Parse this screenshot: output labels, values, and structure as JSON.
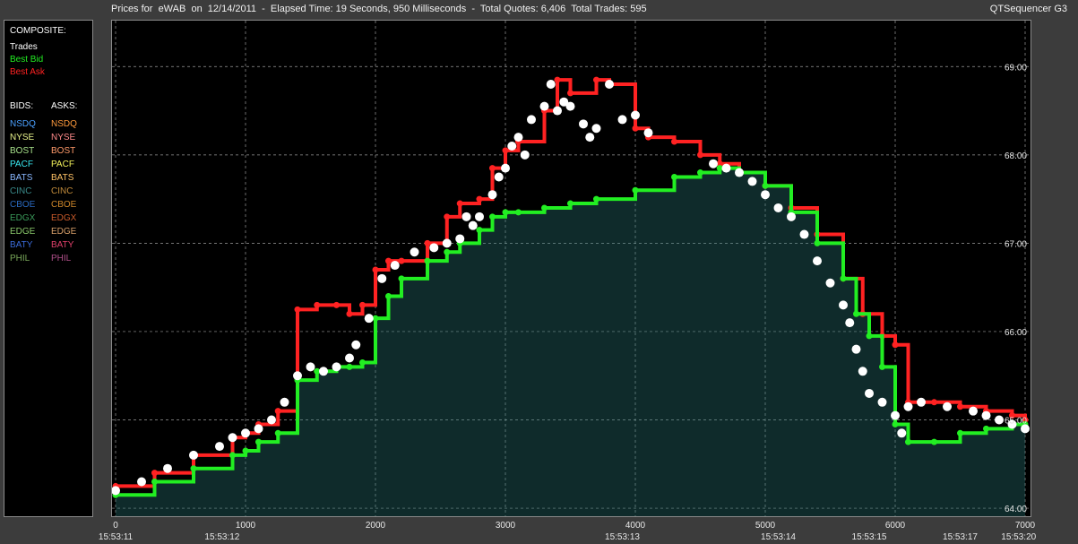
{
  "header": {
    "title": "Prices for  eWAB  on  12/14/2011  -  Elapsed Time: 19 Seconds, 950 Milliseconds  -  Total Quotes: 6,406  Total Trades: 595",
    "app_name": "QTSequencer G3"
  },
  "legend": {
    "composite_title": "COMPOSITE:",
    "composite_items": [
      {
        "label": "Trades",
        "color": "#ffffff"
      },
      {
        "label": "Best Bid",
        "color": "#22ee22"
      },
      {
        "label": "Best Ask",
        "color": "#ff2222"
      }
    ],
    "bids_title": "BIDS:",
    "asks_title": "ASKS:",
    "exchanges": [
      {
        "bid": "NSDQ",
        "ask": "NSDQ",
        "bid_color": "#4aa0ff",
        "ask_color": "#ff9a3c"
      },
      {
        "bid": "NYSE",
        "ask": "NYSE",
        "bid_color": "#e6f08a",
        "ask_color": "#ff8a8a"
      },
      {
        "bid": "BOST",
        "ask": "BOST",
        "bid_color": "#a6e08a",
        "ask_color": "#ff9a6a"
      },
      {
        "bid": "PACF",
        "ask": "PACF",
        "bid_color": "#38e8f0",
        "ask_color": "#f2f05a"
      },
      {
        "bid": "BATS",
        "ask": "BATS",
        "bid_color": "#8ab8ff",
        "ask_color": "#ffc266"
      },
      {
        "bid": "CINC",
        "ask": "CINC",
        "bid_color": "#3a8a8a",
        "ask_color": "#c08a3a"
      },
      {
        "bid": "CBOE",
        "ask": "CBOE",
        "bid_color": "#2a6ac0",
        "ask_color": "#d0882a"
      },
      {
        "bid": "EDGX",
        "ask": "EDGX",
        "bid_color": "#3a9a5a",
        "ask_color": "#c85a2a"
      },
      {
        "bid": "EDGE",
        "ask": "EDGE",
        "bid_color": "#8ac86a",
        "ask_color": "#d8a06a"
      },
      {
        "bid": "BATY",
        "ask": "BATY",
        "bid_color": "#3a6ad8",
        "ask_color": "#e0406a"
      },
      {
        "bid": "PHIL",
        "ask": "PHIL",
        "bid_color": "#7aa85a",
        "ask_color": "#b0508a"
      }
    ]
  },
  "chart_data": {
    "type": "line",
    "title": "Prices for  eWAB  on  12/14/2011",
    "x_ticks": [
      "0",
      "1000",
      "2000",
      "3000",
      "4000",
      "5000",
      "6000",
      "7000"
    ],
    "time_ticks": [
      {
        "x": 0,
        "label": "15:53:11"
      },
      {
        "x": 820,
        "label": "15:53:12"
      },
      {
        "x": 3900,
        "label": "15:53:13"
      },
      {
        "x": 5100,
        "label": "15:53:14"
      },
      {
        "x": 5800,
        "label": "15:53:15"
      },
      {
        "x": 6500,
        "label": "15:53:17"
      },
      {
        "x": 6950,
        "label": "15:53:20"
      }
    ],
    "y_ticks": [
      "64.00",
      "65.00",
      "66.00",
      "67.00",
      "68.00",
      "69.00"
    ],
    "xlim": [
      0,
      7000
    ],
    "ylim": [
      63.95,
      69.5
    ],
    "grid": true,
    "series": [
      {
        "name": "Best Ask",
        "color": "#ff2222",
        "x": [
          0,
          300,
          600,
          900,
          1000,
          1100,
          1250,
          1400,
          1550,
          1700,
          1800,
          1900,
          2000,
          2100,
          2200,
          2400,
          2550,
          2650,
          2800,
          2900,
          3000,
          3100,
          3300,
          3400,
          3500,
          3700,
          3800,
          4000,
          4100,
          4300,
          4500,
          4650,
          4800,
          5000,
          5200,
          5400,
          5600,
          5750,
          5900,
          6000,
          6100,
          6300,
          6500,
          6700,
          6900,
          7000
        ],
        "values": [
          64.25,
          64.4,
          64.6,
          64.8,
          64.85,
          64.95,
          65.1,
          66.25,
          66.3,
          66.3,
          66.2,
          66.3,
          66.7,
          66.8,
          66.8,
          67.0,
          67.3,
          67.45,
          67.5,
          67.85,
          68.05,
          68.15,
          68.5,
          68.85,
          68.7,
          68.85,
          68.8,
          68.3,
          68.2,
          68.15,
          68.0,
          67.9,
          67.8,
          67.65,
          67.4,
          67.1,
          66.6,
          66.2,
          65.95,
          65.85,
          65.2,
          65.2,
          65.15,
          65.1,
          65.05,
          65.0
        ]
      },
      {
        "name": "Best Bid",
        "color": "#22ee22",
        "x": [
          0,
          300,
          600,
          900,
          1000,
          1100,
          1250,
          1400,
          1550,
          1700,
          1800,
          1900,
          2000,
          2100,
          2200,
          2400,
          2550,
          2650,
          2800,
          2900,
          3000,
          3100,
          3300,
          3500,
          3700,
          4000,
          4300,
          4500,
          4650,
          4800,
          5000,
          5200,
          5400,
          5600,
          5700,
          5800,
          5900,
          6000,
          6100,
          6300,
          6500,
          6700,
          6900,
          7000
        ],
        "values": [
          64.15,
          64.3,
          64.45,
          64.6,
          64.65,
          64.75,
          64.85,
          65.45,
          65.55,
          65.6,
          65.6,
          65.65,
          66.15,
          66.4,
          66.6,
          66.8,
          66.9,
          67.0,
          67.15,
          67.3,
          67.35,
          67.35,
          67.4,
          67.45,
          67.5,
          67.6,
          67.75,
          67.8,
          67.85,
          67.8,
          67.65,
          67.35,
          67.0,
          66.6,
          66.2,
          65.95,
          65.6,
          64.95,
          64.75,
          64.75,
          64.85,
          64.9,
          64.95,
          64.95
        ]
      },
      {
        "name": "Trades",
        "color": "#ffffff",
        "x": [
          0,
          200,
          400,
          600,
          800,
          900,
          1000,
          1100,
          1200,
          1300,
          1400,
          1500,
          1600,
          1700,
          1800,
          1850,
          1950,
          2050,
          2150,
          2300,
          2450,
          2550,
          2650,
          2700,
          2750,
          2800,
          2900,
          2950,
          3000,
          3050,
          3100,
          3150,
          3200,
          3300,
          3350,
          3400,
          3450,
          3500,
          3600,
          3650,
          3700,
          3800,
          3900,
          4000,
          4100,
          4600,
          4700,
          4800,
          4900,
          5000,
          5100,
          5200,
          5300,
          5400,
          5500,
          5600,
          5650,
          5700,
          5750,
          5800,
          5900,
          6000,
          6050,
          6100,
          6200,
          6400,
          6600,
          6700,
          6800,
          6900,
          7000
        ],
        "values": [
          64.2,
          64.3,
          64.45,
          64.6,
          64.7,
          64.8,
          64.85,
          64.9,
          65.0,
          65.2,
          65.5,
          65.6,
          65.55,
          65.6,
          65.7,
          65.85,
          66.15,
          66.6,
          66.75,
          66.9,
          66.95,
          67.0,
          67.05,
          67.3,
          67.2,
          67.3,
          67.55,
          67.75,
          67.85,
          68.1,
          68.2,
          68.0,
          68.4,
          68.55,
          68.8,
          68.5,
          68.6,
          68.55,
          68.35,
          68.2,
          68.3,
          68.8,
          68.4,
          68.45,
          68.25,
          67.9,
          67.85,
          67.8,
          67.7,
          67.55,
          67.4,
          67.3,
          67.1,
          66.8,
          66.55,
          66.3,
          66.1,
          65.8,
          65.55,
          65.3,
          65.2,
          65.05,
          64.85,
          65.15,
          65.2,
          65.15,
          65.1,
          65.05,
          65.0,
          64.95,
          64.9
        ]
      }
    ]
  }
}
